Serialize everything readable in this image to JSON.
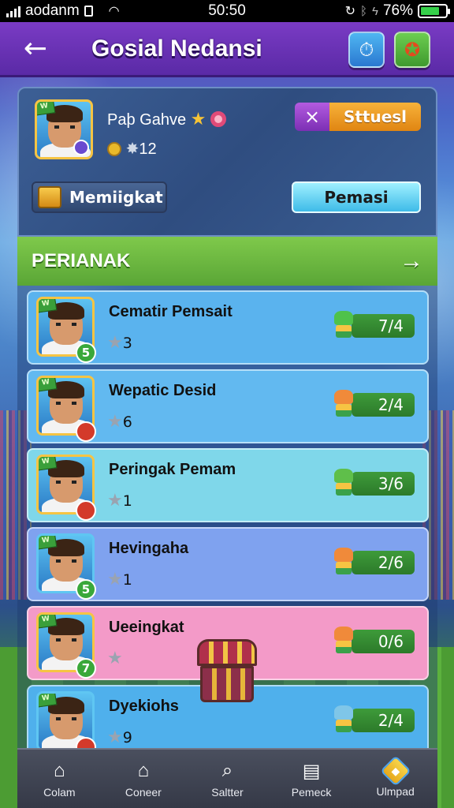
{
  "status_bar": {
    "carrier": "aodanm",
    "time": "50:50",
    "battery": "76%"
  },
  "header": {
    "title": "Gosial Nedansi"
  },
  "profile": {
    "name": "Paþ Gahve",
    "coins": "12",
    "x_label": "×",
    "status_label": "Sttuesl",
    "rank_label": "Memiigkat",
    "action_label": "Pemasi"
  },
  "section": {
    "title": "PERIANAK"
  },
  "rows": [
    {
      "name": "Cematir Pemsait",
      "stat": "3",
      "level": "5",
      "score": "7/4",
      "bg": "#5ab3ee",
      "level_color": "#3aa83a"
    },
    {
      "name": "Wepatic Desid",
      "stat": "6",
      "level": "",
      "score": "2/4",
      "bg": "#62b9f0",
      "level_color": "#d33a2a"
    },
    {
      "name": "Peringak Pemam",
      "stat": "1",
      "level": "",
      "score": "3/6",
      "bg": "#7fd7ea",
      "level_color": "#d33a2a"
    },
    {
      "name": "Hevingaha",
      "stat": "1",
      "level": "5",
      "score": "2/6",
      "bg": "#7fa2ef",
      "level_color": "#3aa83a"
    },
    {
      "name": "Ueeingkat",
      "stat": "",
      "level": "7",
      "score": "0/6",
      "bg": "#f39ac8",
      "level_color": "#3aa83a"
    },
    {
      "name": "Dyekiohs",
      "stat": "9",
      "level": "",
      "score": "2/4",
      "bg": "#4fb0ec",
      "level_color": "#d33a2a"
    }
  ],
  "nav": [
    {
      "label": "Colam",
      "icon": "home-icon"
    },
    {
      "label": "Coneer",
      "icon": "house-icon"
    },
    {
      "label": "Saltter",
      "icon": "search-icon"
    },
    {
      "label": "Pemeck",
      "icon": "clipboard-icon"
    },
    {
      "label": "Ulmpad",
      "icon": "gem-icon"
    }
  ]
}
